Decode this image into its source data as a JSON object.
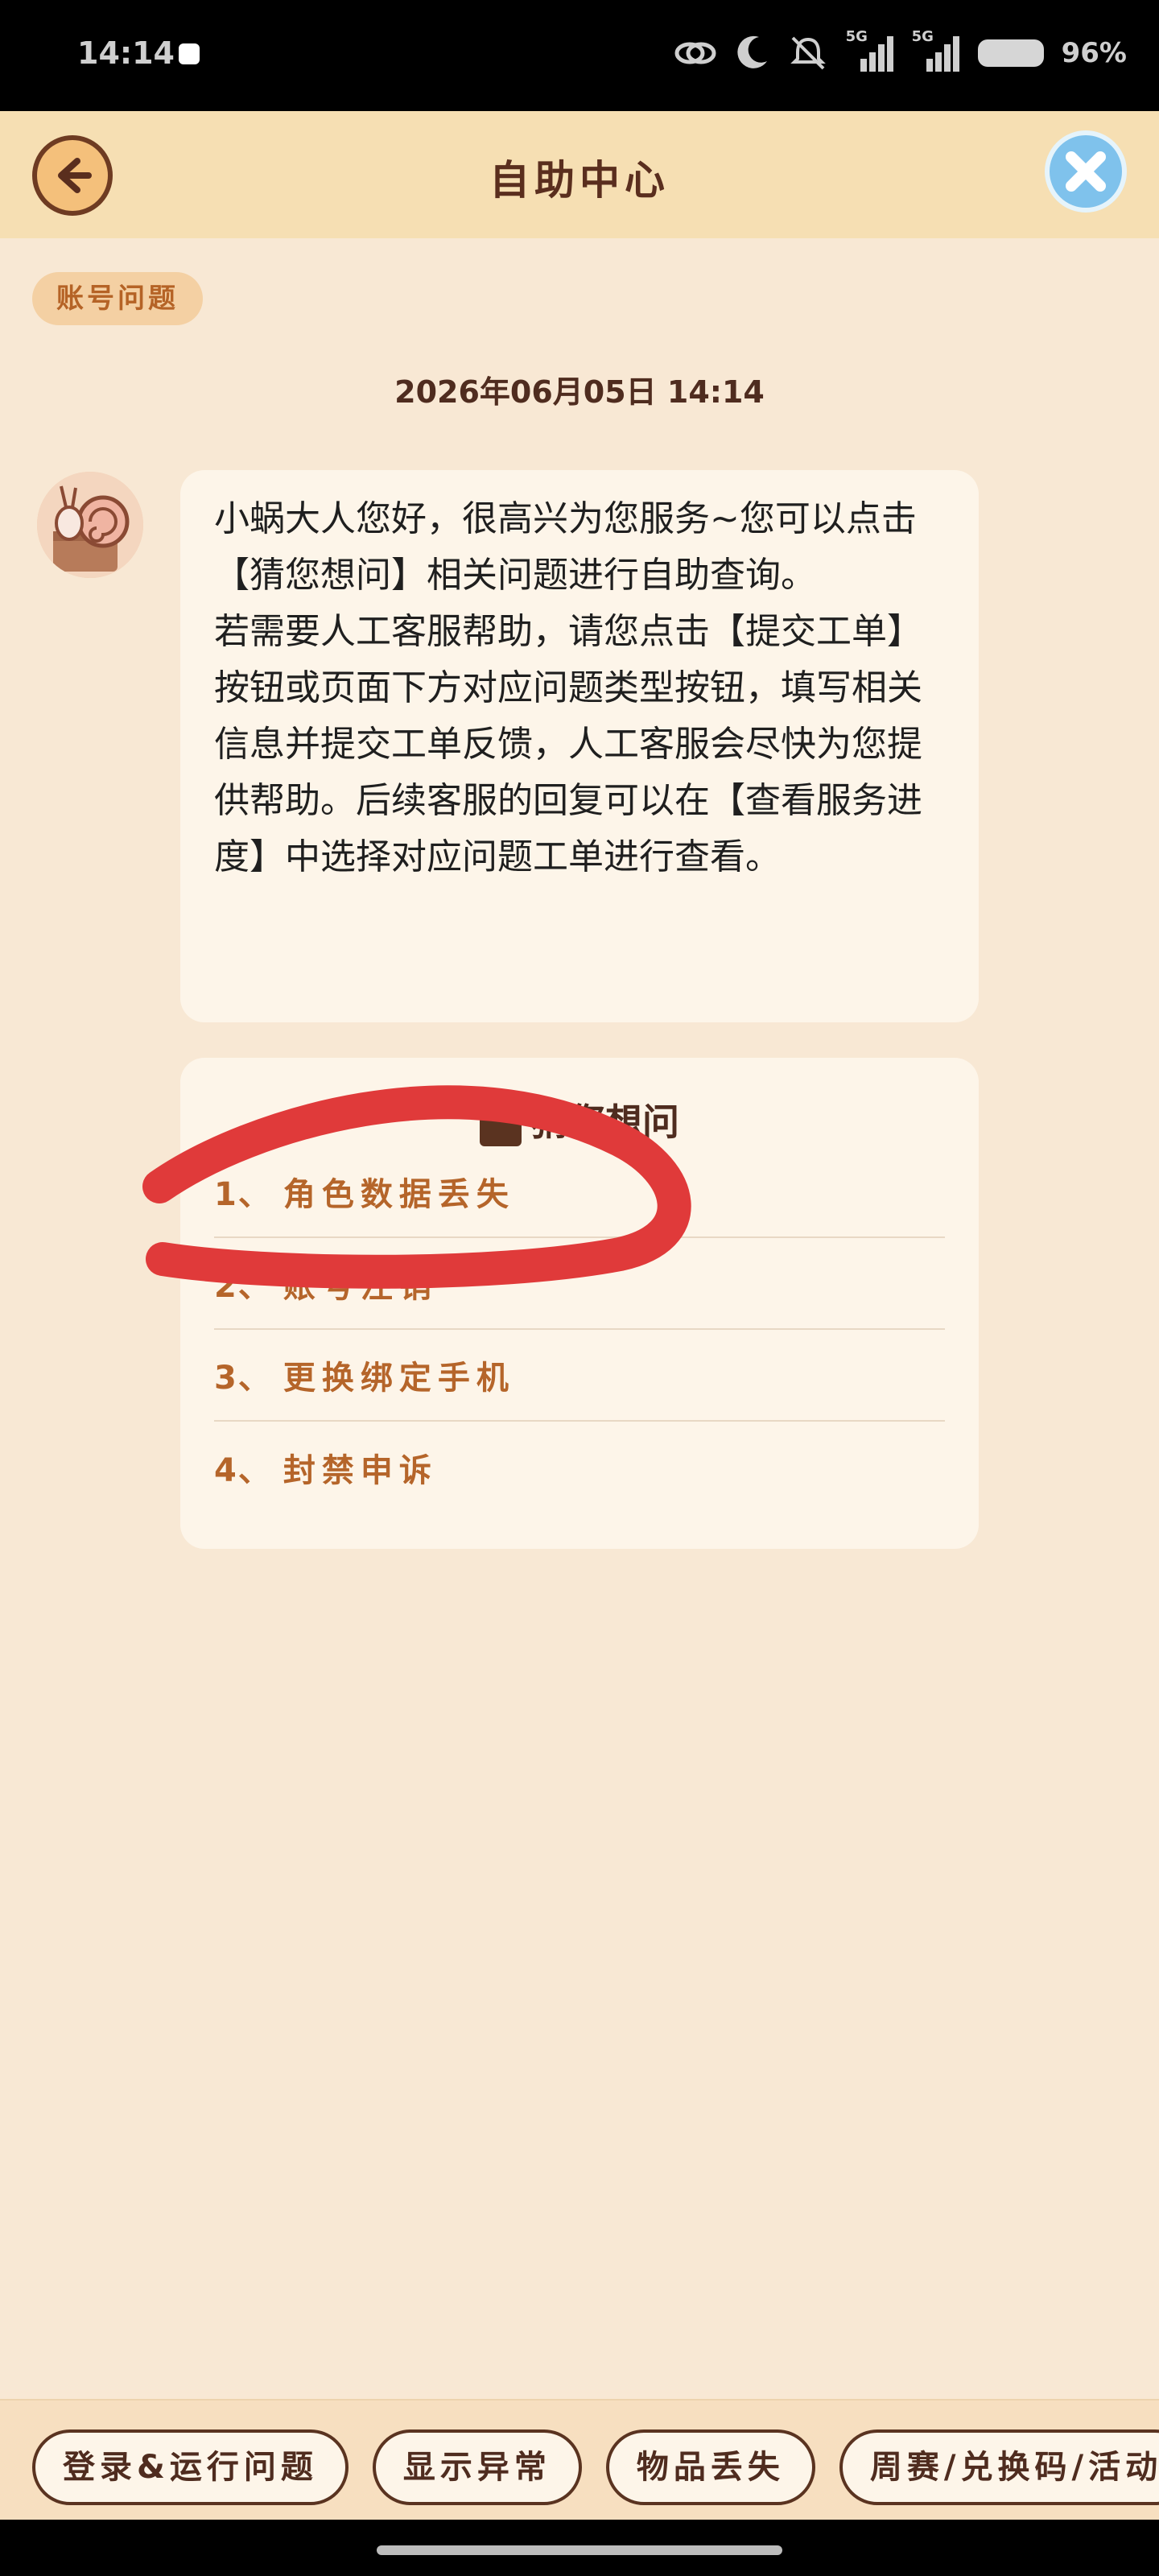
{
  "status_bar": {
    "time": "14:14",
    "signal_label_1": "5G",
    "signal_label_2": "5G",
    "battery": "96%"
  },
  "header": {
    "title": "自助中心"
  },
  "category_badge": "账号问题",
  "chat": {
    "date": "2026年06月05日  14:14",
    "message_paragraph_1": "小蜗大人您好，很高兴为您服务~您可以点击【猜您想问】相关问题进行自助查询。",
    "message_paragraph_2": "若需要人工客服帮助，请您点击【提交工单】按钮或页面下方对应问题类型按钮，填写相关信息并提交工单反馈，人工客服会尽快为您提供帮助。后续客服的回复可以在【查看服务进度】中选择对应问题工单进行查看。"
  },
  "faq": {
    "title": "猜您想问",
    "items": [
      {
        "num": "1、",
        "label": "角色数据丢失"
      },
      {
        "num": "2、",
        "label": "账号注销"
      },
      {
        "num": "3、",
        "label": "更换绑定手机"
      },
      {
        "num": "4、",
        "label": "封禁申诉"
      }
    ]
  },
  "bottom_chips": [
    "登录&运行问题",
    "显示异常",
    "物品丢失",
    "周赛/兑换码/活动"
  ],
  "colors": {
    "page_bg": "#f8e8d4",
    "header_bg": "#f6dfb3",
    "accent_orange": "#b5652a",
    "scribble_red": "#e03a3a"
  }
}
